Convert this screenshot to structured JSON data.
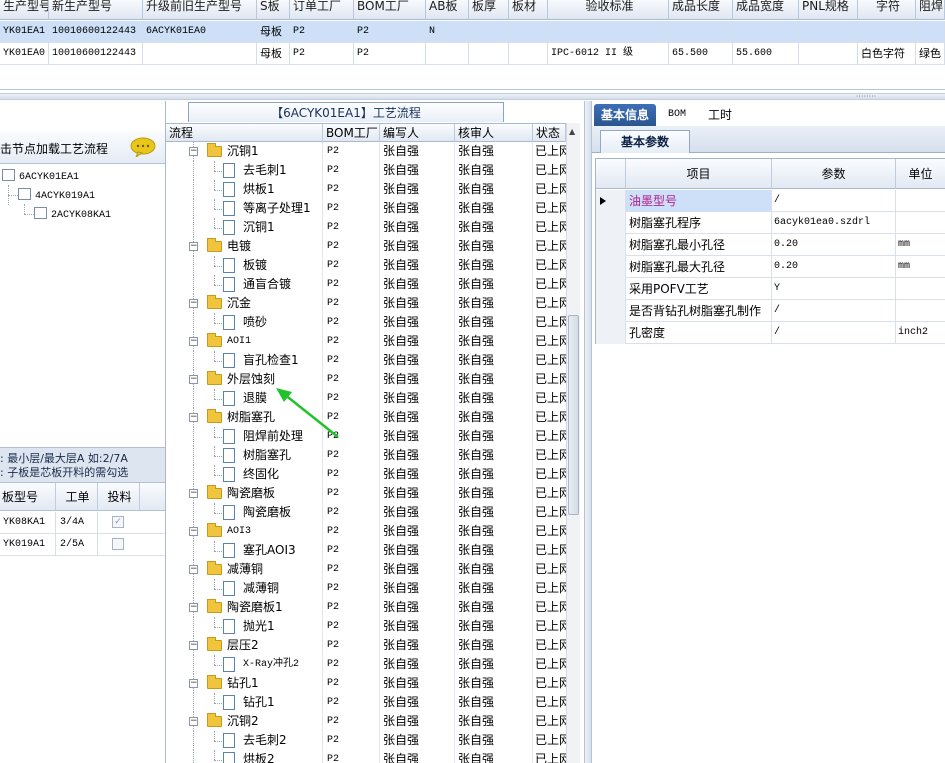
{
  "top_grid": {
    "columns": [
      "生产型号",
      "新生产型号",
      "升级前旧生产型号",
      "S板",
      "订单工厂",
      "BOM工厂",
      "AB板",
      "板厚",
      "板材",
      "验收标准",
      "成品长度",
      "成品宽度",
      "PNL规格",
      "字符",
      "阻焊"
    ],
    "rows": [
      {
        "c0": "YK01EA1",
        "c1": "10010600122443",
        "c2": "6ACYK01EA0",
        "c3": "母板",
        "c4": "P2",
        "c5": "P2",
        "c6": "N",
        "c7": "",
        "c8": "",
        "c9": "",
        "c10": "",
        "c11": "",
        "c12": "",
        "c13": "",
        "c14": ""
      },
      {
        "c0": "YK01EA0",
        "c1": "10010600122443",
        "c2": "",
        "c3": "母板",
        "c4": "P2",
        "c5": "P2",
        "c6": "",
        "c7": "",
        "c8": "",
        "c9": "IPC-6012 II 级",
        "c10": "65.500",
        "c11": "55.600",
        "c12": "",
        "c13": "白色字符",
        "c14": "绿色"
      }
    ]
  },
  "splitter": {
    "grip": "········"
  },
  "left_panel": {
    "header": "击节点加载工艺流程",
    "tree": [
      "6ACYK01EA1",
      "4ACYK019A1",
      "2ACYK08KA1"
    ],
    "hint_line1": ": 最小层/最大层A 如:2/7A",
    "hint_line2": ": 子板是芯板开料的需勾选",
    "grid_columns": [
      "板型号",
      "工单",
      "投料"
    ],
    "grid_rows": [
      {
        "model": "YK08KA1",
        "order": "3/4A",
        "checked": "✓"
      },
      {
        "model": "YK019A1",
        "order": "2/5A",
        "checked": ""
      }
    ]
  },
  "middle_panel": {
    "title": "【6ACYK01EA1】工艺流程",
    "columns": [
      "流程",
      "BOM工厂",
      "编写人",
      "核审人",
      "状态"
    ],
    "rows": [
      {
        "name": "沉铜1",
        "type": "folder",
        "bom": "P2",
        "writer": "张自强",
        "reviewer": "张自强",
        "status": "已上网"
      },
      {
        "name": "去毛刺1",
        "type": "doc",
        "bom": "P2",
        "writer": "张自强",
        "reviewer": "张自强",
        "status": "已上网"
      },
      {
        "name": "烘板1",
        "type": "doc",
        "bom": "P2",
        "writer": "张自强",
        "reviewer": "张自强",
        "status": "已上网"
      },
      {
        "name": "等离子处理1",
        "type": "doc",
        "bom": "P2",
        "writer": "张自强",
        "reviewer": "张自强",
        "status": "已上网"
      },
      {
        "name": "沉铜1",
        "type": "doc",
        "bom": "P2",
        "writer": "张自强",
        "reviewer": "张自强",
        "status": "已上网"
      },
      {
        "name": "电镀",
        "type": "folder",
        "bom": "P2",
        "writer": "张自强",
        "reviewer": "张自强",
        "status": "已上网"
      },
      {
        "name": "板镀",
        "type": "doc",
        "bom": "P2",
        "writer": "张自强",
        "reviewer": "张自强",
        "status": "已上网"
      },
      {
        "name": "通盲合镀",
        "type": "doc",
        "bom": "P2",
        "writer": "张自强",
        "reviewer": "张自强",
        "status": "已上网"
      },
      {
        "name": "沉金",
        "type": "folder",
        "bom": "P2",
        "writer": "张自强",
        "reviewer": "张自强",
        "status": "已上网"
      },
      {
        "name": "喷砂",
        "type": "doc",
        "bom": "P2",
        "writer": "张自强",
        "reviewer": "张自强",
        "status": "已上网"
      },
      {
        "name": "AOI1",
        "type": "folder",
        "bom": "P2",
        "writer": "张自强",
        "reviewer": "张自强",
        "status": "已上网"
      },
      {
        "name": "盲孔检查1",
        "type": "doc",
        "bom": "P2",
        "writer": "张自强",
        "reviewer": "张自强",
        "status": "已上网"
      },
      {
        "name": "外层蚀刻",
        "type": "folder",
        "bom": "P2",
        "writer": "张自强",
        "reviewer": "张自强",
        "status": "已上网"
      },
      {
        "name": "退膜",
        "type": "doc",
        "bom": "P2",
        "writer": "张自强",
        "reviewer": "张自强",
        "status": "已上网"
      },
      {
        "name": "树脂塞孔",
        "type": "folder",
        "bom": "P2",
        "writer": "张自强",
        "reviewer": "张自强",
        "status": "已上网"
      },
      {
        "name": "阻焊前处理",
        "type": "doc",
        "bom": "P2",
        "writer": "张自强",
        "reviewer": "张自强",
        "status": "已上网"
      },
      {
        "name": "树脂塞孔",
        "type": "doc",
        "bom": "P2",
        "writer": "张自强",
        "reviewer": "张自强",
        "status": "已上网"
      },
      {
        "name": "终固化",
        "type": "doc",
        "bom": "P2",
        "writer": "张自强",
        "reviewer": "张自强",
        "status": "已上网"
      },
      {
        "name": "陶瓷磨板",
        "type": "folder",
        "bom": "P2",
        "writer": "张自强",
        "reviewer": "张自强",
        "status": "已上网"
      },
      {
        "name": "陶瓷磨板",
        "type": "doc",
        "bom": "P2",
        "writer": "张自强",
        "reviewer": "张自强",
        "status": "已上网"
      },
      {
        "name": "AOI3",
        "type": "folder",
        "bom": "P2",
        "writer": "张自强",
        "reviewer": "张自强",
        "status": "已上网"
      },
      {
        "name": "塞孔AOI3",
        "type": "doc",
        "bom": "P2",
        "writer": "张自强",
        "reviewer": "张自强",
        "status": "已上网"
      },
      {
        "name": "减薄铜",
        "type": "folder",
        "bom": "P2",
        "writer": "张自强",
        "reviewer": "张自强",
        "status": "已上网"
      },
      {
        "name": "减薄铜",
        "type": "doc",
        "bom": "P2",
        "writer": "张自强",
        "reviewer": "张自强",
        "status": "已上网"
      },
      {
        "name": "陶瓷磨板1",
        "type": "folder",
        "bom": "P2",
        "writer": "张自强",
        "reviewer": "张自强",
        "status": "已上网"
      },
      {
        "name": "抛光1",
        "type": "doc",
        "bom": "P2",
        "writer": "张自强",
        "reviewer": "张自强",
        "status": "已上网"
      },
      {
        "name": "层压2",
        "type": "folder",
        "bom": "P2",
        "writer": "张自强",
        "reviewer": "张自强",
        "status": "已上网"
      },
      {
        "name": "X-Ray冲孔2",
        "type": "doc",
        "bom": "P2",
        "writer": "张自强",
        "reviewer": "张自强",
        "status": "已上网"
      },
      {
        "name": "钻孔1",
        "type": "folder",
        "bom": "P2",
        "writer": "张自强",
        "reviewer": "张自强",
        "status": "已上网"
      },
      {
        "name": "钻孔1",
        "type": "doc",
        "bom": "P2",
        "writer": "张自强",
        "reviewer": "张自强",
        "status": "已上网"
      },
      {
        "name": "沉铜2",
        "type": "folder",
        "bom": "P2",
        "writer": "张自强",
        "reviewer": "张自强",
        "status": "已上网"
      },
      {
        "name": "去毛刺2",
        "type": "doc",
        "bom": "P2",
        "writer": "张自强",
        "reviewer": "张自强",
        "status": "已上网"
      },
      {
        "name": "烘板2",
        "type": "doc",
        "bom": "P2",
        "writer": "张自强",
        "reviewer": "张自强",
        "status": "已上网"
      }
    ]
  },
  "right_panel": {
    "tabs": [
      "基本信息",
      "BOM",
      "工时"
    ],
    "sub_tab": "基本参数",
    "param_columns": [
      "项目",
      "参数",
      "单位"
    ],
    "params": [
      {
        "item": "油墨型号",
        "value": "/",
        "unit": ""
      },
      {
        "item": "树脂塞孔程序",
        "value": "6acyk01ea0.szdrl",
        "unit": ""
      },
      {
        "item": "树脂塞孔最小孔径",
        "value": "0.20",
        "unit": "mm"
      },
      {
        "item": "树脂塞孔最大孔径",
        "value": "0.20",
        "unit": "mm"
      },
      {
        "item": "采用POFV工艺",
        "value": "Y",
        "unit": ""
      },
      {
        "item": "是否背钻孔树脂塞孔制作",
        "value": "/",
        "unit": ""
      },
      {
        "item": "孔密度",
        "value": "/",
        "unit": "inch2"
      }
    ]
  },
  "colors": {
    "selected": "#cde0f7",
    "tab_active": "#2f5f9e",
    "arrow": "#22c22a",
    "folder": "#f0c43c"
  }
}
